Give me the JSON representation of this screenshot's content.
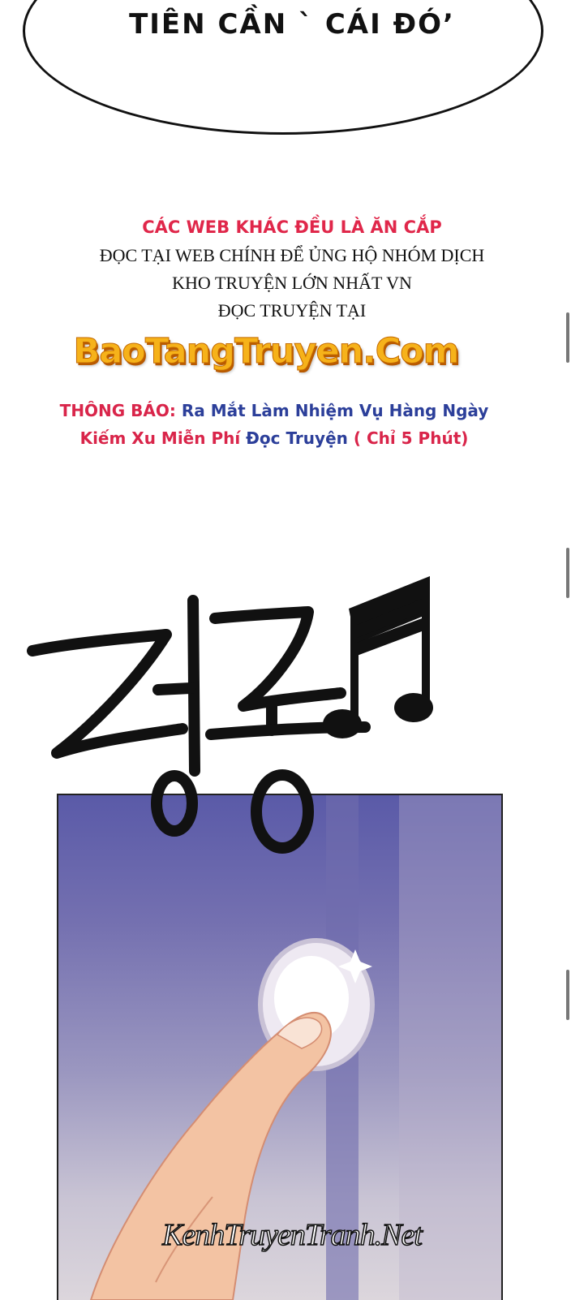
{
  "speech_bubble": {
    "text": "TIÊN CẦN ` CÁI ĐÓ’"
  },
  "notice": {
    "warning": "CÁC WEB KHÁC ĐỀU LÀ ĂN CẮP",
    "line1": "ĐỌC TẠI WEB CHÍNH ĐỂ ỦNG HỘ NHÓM DỊCH",
    "line2": "KHO TRUYỆN LỚN NHẤT VN",
    "line3": "ĐỌC TRUYỆN TẠI"
  },
  "site_name": "BaoTangTruyen.Com",
  "announcement": {
    "label": "THÔNG BÁO:",
    "line1_blue": "Ra Mắt Làm Nhiệm Vụ Hàng Ngày",
    "line2_red": "Kiếm Xu Miễn Phí",
    "line2_blue": "Đọc Truyện",
    "line2_red_end": "( Chỉ 5 Phút)"
  },
  "sfx": {
    "text": "딩동♫"
  },
  "watermark": "KenhTruyenTranh.Net",
  "colors": {
    "accent_red": "#d9254a",
    "accent_blue": "#2c3f9a",
    "site_gold": "#f6b21a"
  }
}
